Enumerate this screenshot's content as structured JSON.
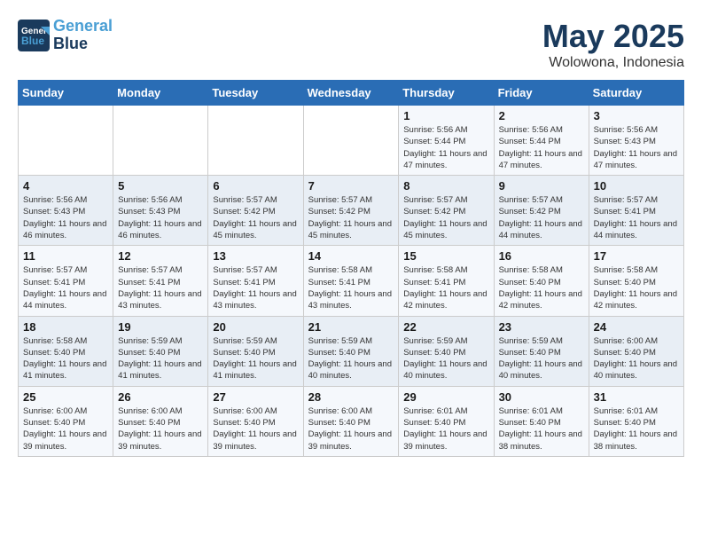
{
  "header": {
    "logo_line1": "General",
    "logo_line2": "Blue",
    "month": "May 2025",
    "location": "Wolowona, Indonesia"
  },
  "weekdays": [
    "Sunday",
    "Monday",
    "Tuesday",
    "Wednesday",
    "Thursday",
    "Friday",
    "Saturday"
  ],
  "weeks": [
    [
      null,
      null,
      null,
      null,
      {
        "day": 1,
        "sunrise": "Sunrise: 5:56 AM",
        "sunset": "Sunset: 5:44 PM",
        "daylight": "Daylight: 11 hours and 47 minutes."
      },
      {
        "day": 2,
        "sunrise": "Sunrise: 5:56 AM",
        "sunset": "Sunset: 5:44 PM",
        "daylight": "Daylight: 11 hours and 47 minutes."
      },
      {
        "day": 3,
        "sunrise": "Sunrise: 5:56 AM",
        "sunset": "Sunset: 5:43 PM",
        "daylight": "Daylight: 11 hours and 47 minutes."
      }
    ],
    [
      {
        "day": 4,
        "sunrise": "Sunrise: 5:56 AM",
        "sunset": "Sunset: 5:43 PM",
        "daylight": "Daylight: 11 hours and 46 minutes."
      },
      {
        "day": 5,
        "sunrise": "Sunrise: 5:56 AM",
        "sunset": "Sunset: 5:43 PM",
        "daylight": "Daylight: 11 hours and 46 minutes."
      },
      {
        "day": 6,
        "sunrise": "Sunrise: 5:57 AM",
        "sunset": "Sunset: 5:42 PM",
        "daylight": "Daylight: 11 hours and 45 minutes."
      },
      {
        "day": 7,
        "sunrise": "Sunrise: 5:57 AM",
        "sunset": "Sunset: 5:42 PM",
        "daylight": "Daylight: 11 hours and 45 minutes."
      },
      {
        "day": 8,
        "sunrise": "Sunrise: 5:57 AM",
        "sunset": "Sunset: 5:42 PM",
        "daylight": "Daylight: 11 hours and 45 minutes."
      },
      {
        "day": 9,
        "sunrise": "Sunrise: 5:57 AM",
        "sunset": "Sunset: 5:42 PM",
        "daylight": "Daylight: 11 hours and 44 minutes."
      },
      {
        "day": 10,
        "sunrise": "Sunrise: 5:57 AM",
        "sunset": "Sunset: 5:41 PM",
        "daylight": "Daylight: 11 hours and 44 minutes."
      }
    ],
    [
      {
        "day": 11,
        "sunrise": "Sunrise: 5:57 AM",
        "sunset": "Sunset: 5:41 PM",
        "daylight": "Daylight: 11 hours and 44 minutes."
      },
      {
        "day": 12,
        "sunrise": "Sunrise: 5:57 AM",
        "sunset": "Sunset: 5:41 PM",
        "daylight": "Daylight: 11 hours and 43 minutes."
      },
      {
        "day": 13,
        "sunrise": "Sunrise: 5:57 AM",
        "sunset": "Sunset: 5:41 PM",
        "daylight": "Daylight: 11 hours and 43 minutes."
      },
      {
        "day": 14,
        "sunrise": "Sunrise: 5:58 AM",
        "sunset": "Sunset: 5:41 PM",
        "daylight": "Daylight: 11 hours and 43 minutes."
      },
      {
        "day": 15,
        "sunrise": "Sunrise: 5:58 AM",
        "sunset": "Sunset: 5:41 PM",
        "daylight": "Daylight: 11 hours and 42 minutes."
      },
      {
        "day": 16,
        "sunrise": "Sunrise: 5:58 AM",
        "sunset": "Sunset: 5:40 PM",
        "daylight": "Daylight: 11 hours and 42 minutes."
      },
      {
        "day": 17,
        "sunrise": "Sunrise: 5:58 AM",
        "sunset": "Sunset: 5:40 PM",
        "daylight": "Daylight: 11 hours and 42 minutes."
      }
    ],
    [
      {
        "day": 18,
        "sunrise": "Sunrise: 5:58 AM",
        "sunset": "Sunset: 5:40 PM",
        "daylight": "Daylight: 11 hours and 41 minutes."
      },
      {
        "day": 19,
        "sunrise": "Sunrise: 5:59 AM",
        "sunset": "Sunset: 5:40 PM",
        "daylight": "Daylight: 11 hours and 41 minutes."
      },
      {
        "day": 20,
        "sunrise": "Sunrise: 5:59 AM",
        "sunset": "Sunset: 5:40 PM",
        "daylight": "Daylight: 11 hours and 41 minutes."
      },
      {
        "day": 21,
        "sunrise": "Sunrise: 5:59 AM",
        "sunset": "Sunset: 5:40 PM",
        "daylight": "Daylight: 11 hours and 40 minutes."
      },
      {
        "day": 22,
        "sunrise": "Sunrise: 5:59 AM",
        "sunset": "Sunset: 5:40 PM",
        "daylight": "Daylight: 11 hours and 40 minutes."
      },
      {
        "day": 23,
        "sunrise": "Sunrise: 5:59 AM",
        "sunset": "Sunset: 5:40 PM",
        "daylight": "Daylight: 11 hours and 40 minutes."
      },
      {
        "day": 24,
        "sunrise": "Sunrise: 6:00 AM",
        "sunset": "Sunset: 5:40 PM",
        "daylight": "Daylight: 11 hours and 40 minutes."
      }
    ],
    [
      {
        "day": 25,
        "sunrise": "Sunrise: 6:00 AM",
        "sunset": "Sunset: 5:40 PM",
        "daylight": "Daylight: 11 hours and 39 minutes."
      },
      {
        "day": 26,
        "sunrise": "Sunrise: 6:00 AM",
        "sunset": "Sunset: 5:40 PM",
        "daylight": "Daylight: 11 hours and 39 minutes."
      },
      {
        "day": 27,
        "sunrise": "Sunrise: 6:00 AM",
        "sunset": "Sunset: 5:40 PM",
        "daylight": "Daylight: 11 hours and 39 minutes."
      },
      {
        "day": 28,
        "sunrise": "Sunrise: 6:00 AM",
        "sunset": "Sunset: 5:40 PM",
        "daylight": "Daylight: 11 hours and 39 minutes."
      },
      {
        "day": 29,
        "sunrise": "Sunrise: 6:01 AM",
        "sunset": "Sunset: 5:40 PM",
        "daylight": "Daylight: 11 hours and 39 minutes."
      },
      {
        "day": 30,
        "sunrise": "Sunrise: 6:01 AM",
        "sunset": "Sunset: 5:40 PM",
        "daylight": "Daylight: 11 hours and 38 minutes."
      },
      {
        "day": 31,
        "sunrise": "Sunrise: 6:01 AM",
        "sunset": "Sunset: 5:40 PM",
        "daylight": "Daylight: 11 hours and 38 minutes."
      }
    ]
  ]
}
